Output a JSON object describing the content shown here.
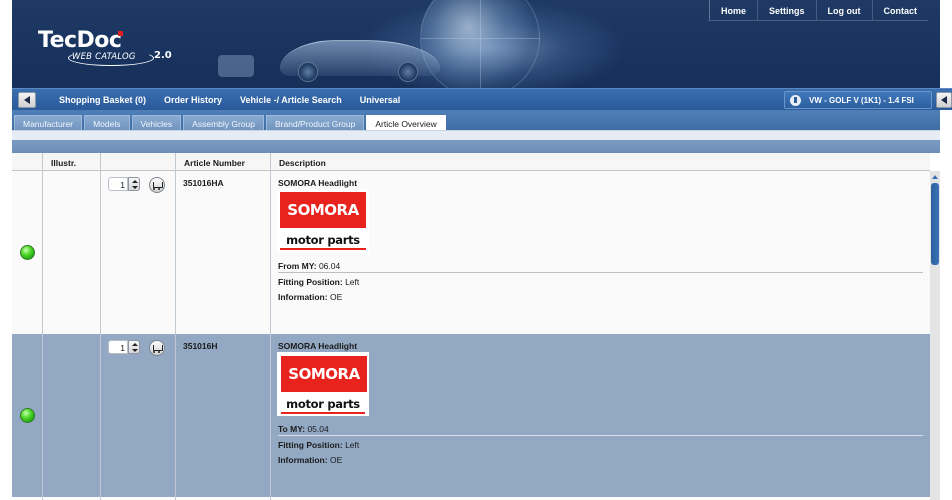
{
  "header": {
    "logo_title": "TecDoc",
    "logo_subtitle": "WEB CATALOG",
    "logo_version": "2.0",
    "top_nav": [
      "Home",
      "Settings",
      "Log out",
      "Contact"
    ]
  },
  "menu": {
    "items": [
      "Shopping Basket (0)",
      "Order History",
      "Vehicle -/ Article Search",
      "Universal"
    ],
    "vehicle": "VW - GOLF V (1K1) - 1.4 FSI"
  },
  "tabs": {
    "items": [
      "Manufacturer",
      "Models",
      "Vehicles",
      "Assembly Group",
      "Brand/Product Group",
      "Article Overview"
    ],
    "active": "Article Overview"
  },
  "grid": {
    "columns": [
      "Illustr.",
      "Article Number",
      "Description"
    ],
    "rows": [
      {
        "quantity": "1",
        "article_number": "351016HA",
        "title": "SOMORA Headlight",
        "brand_name": "SOMORA",
        "brand_tagline": "motor parts",
        "model_year_label": "From MY:",
        "model_year_value": "06.04",
        "fitting_label": "Fitting Position:",
        "fitting_value": "Left",
        "info_label": "Information:",
        "info_value": "OE",
        "status_color": "#2fbf16"
      },
      {
        "quantity": "1",
        "article_number": "351016H",
        "title": "SOMORA Headlight",
        "brand_name": "SOMORA",
        "brand_tagline": "motor parts",
        "model_year_label": "To MY:",
        "model_year_value": "05.04",
        "fitting_label": "Fitting Position:",
        "fitting_value": "Left",
        "info_label": "Information:",
        "info_value": "OE",
        "status_color": "#2fbf16"
      }
    ]
  },
  "colors": {
    "header_bg": "#1a3460",
    "menubar_bg": "#2a5a9a",
    "selected_row_bg": "#93a9c3",
    "brand_red": "#e8221c"
  }
}
